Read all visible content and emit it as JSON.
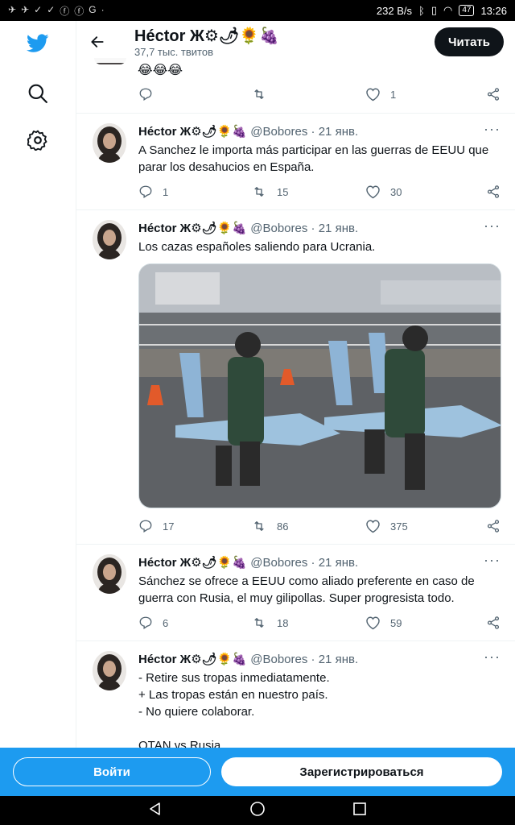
{
  "status_bar": {
    "left_icons": [
      "✈",
      "✈",
      "✓",
      "✓",
      "ⓕ",
      "ⓕ",
      "G",
      "·"
    ],
    "net_speed": "232 B/s",
    "battery": "47",
    "time": "13:26"
  },
  "nav": {
    "logo_icon": "twitter-bird-icon",
    "search_icon": "search-icon",
    "settings_icon": "gear-icon"
  },
  "header": {
    "name": "Héctor Ж⚙🌶🌻🍇",
    "subtitle": "37,7 тыс. твитов",
    "read_button": "Читать"
  },
  "top_tweet": {
    "emojis": "😂😂😂",
    "likes": "1"
  },
  "tweets": [
    {
      "name": "Héctor Ж⚙🌶🌻🍇",
      "handle": "@Bobores",
      "date": "21 янв.",
      "text": "A Sanchez le importa más participar en las guerras de EEUU que parar los desahucios en España.",
      "replies": "1",
      "retweets": "15",
      "likes": "30"
    },
    {
      "name": "Héctor Ж⚙🌶🌻🍇",
      "handle": "@Bobores",
      "date": "21 янв.",
      "text": "Los cazas españoles saliendo para Ucrania.",
      "replies": "17",
      "retweets": "86",
      "likes": "375"
    },
    {
      "name": "Héctor Ж⚙🌶🌻🍇",
      "handle": "@Bobores",
      "date": "21 янв.",
      "text": "Sánchez se ofrece a EEUU como aliado preferente en caso de guerra con Rusia, el muy gilipollas. Super progresista todo.",
      "replies": "6",
      "retweets": "18",
      "likes": "59"
    },
    {
      "name": "Héctor Ж⚙🌶🌻🍇",
      "handle": "@Bobores",
      "date": "21 янв.",
      "text": "- Retire sus tropas inmediatamente.\n+ Las tropas están en nuestro país.\n- No quiere colaborar.\n\nOTAN vs Rusia"
    }
  ],
  "bottom_bar": {
    "login": "Войти",
    "signup": "Зарегистрироваться"
  },
  "colors": {
    "brand": "#1d9bf0",
    "text": "#0f1419",
    "muted": "#536471"
  }
}
